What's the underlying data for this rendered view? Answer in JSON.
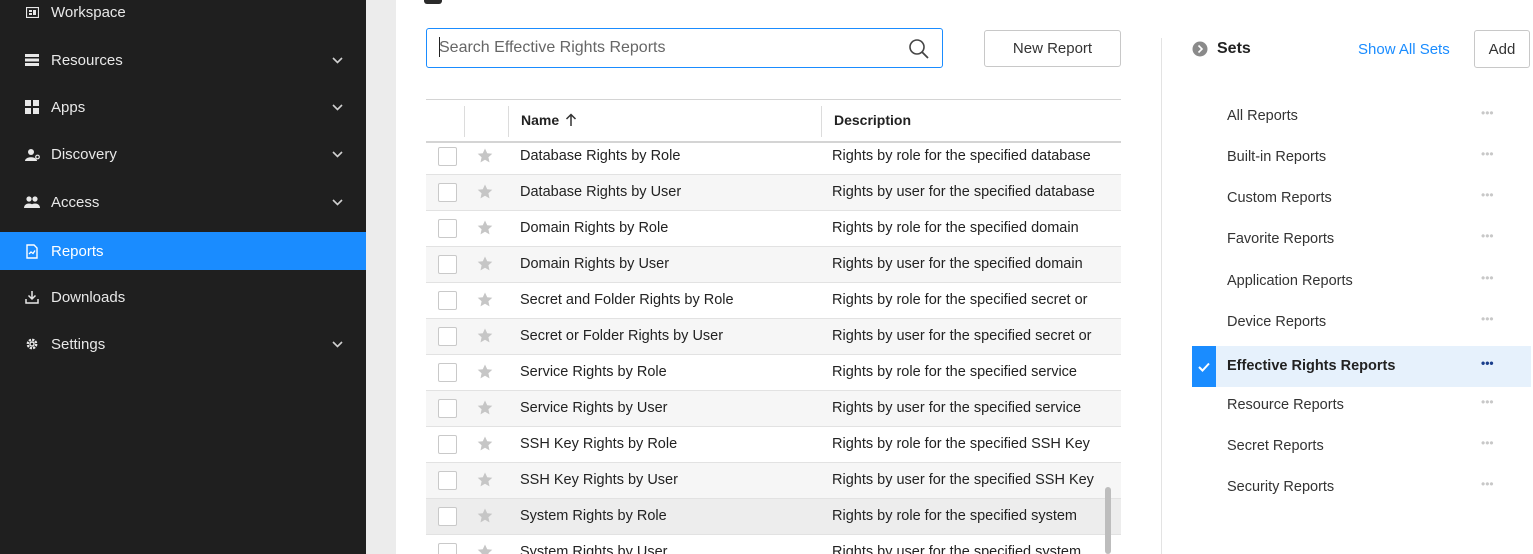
{
  "sidebar": {
    "items": [
      {
        "label": "Workspace",
        "icon": "workspace-icon",
        "chevron": false
      },
      {
        "label": "Resources",
        "icon": "list-icon",
        "chevron": true
      },
      {
        "label": "Apps",
        "icon": "apps-icon",
        "chevron": true
      },
      {
        "label": "Discovery",
        "icon": "discovery-icon",
        "chevron": true
      },
      {
        "label": "Access",
        "icon": "users-icon",
        "chevron": true
      },
      {
        "label": "Reports",
        "icon": "reports-icon",
        "chevron": false,
        "active": true
      },
      {
        "label": "Downloads",
        "icon": "download-icon",
        "chevron": false
      },
      {
        "label": "Settings",
        "icon": "gear-icon",
        "chevron": true
      }
    ]
  },
  "search": {
    "placeholder": "Search Effective Rights Reports",
    "value": ""
  },
  "toolbar": {
    "new_report_label": "New Report"
  },
  "table": {
    "columns": {
      "name": "Name",
      "description": "Description"
    },
    "sort": "ascending",
    "rows": [
      {
        "name": "Database Rights by Role",
        "description": "Rights by role for the specified database"
      },
      {
        "name": "Database Rights by User",
        "description": "Rights by user for the specified database"
      },
      {
        "name": "Domain Rights by Role",
        "description": "Rights by role for the specified domain"
      },
      {
        "name": "Domain Rights by User",
        "description": "Rights by user for the specified domain"
      },
      {
        "name": "Secret and Folder Rights by Role",
        "description": "Rights by role for the specified secret or"
      },
      {
        "name": "Secret or Folder Rights by User",
        "description": "Rights by user for the specified secret or"
      },
      {
        "name": "Service Rights by Role",
        "description": "Rights by role for the specified service"
      },
      {
        "name": "Service Rights by User",
        "description": "Rights by user for the specified service"
      },
      {
        "name": "SSH Key Rights by Role",
        "description": "Rights by role for the specified SSH Key"
      },
      {
        "name": "SSH Key Rights by User",
        "description": "Rights by user for the specified SSH Key"
      },
      {
        "name": "System Rights by Role",
        "description": "Rights by role for the specified system"
      },
      {
        "name": "System Rights by User",
        "description": "Rights by user for the specified system"
      }
    ]
  },
  "sets": {
    "title": "Sets",
    "show_all_label": "Show All Sets",
    "add_label": "Add",
    "items": [
      {
        "label": "All Reports"
      },
      {
        "label": "Built-in Reports"
      },
      {
        "label": "Custom Reports"
      },
      {
        "label": "Favorite Reports"
      },
      {
        "label": "Application Reports"
      },
      {
        "label": "Device Reports"
      },
      {
        "label": "Effective Rights Reports",
        "active": true
      },
      {
        "label": "Resource Reports"
      },
      {
        "label": "Secret Reports"
      },
      {
        "label": "Security Reports"
      }
    ],
    "more_glyph": "•••"
  },
  "colors": {
    "accent": "#1a8cff",
    "sidebar_bg": "#1f1f1f",
    "active_set_bg": "#e6f1fc"
  }
}
